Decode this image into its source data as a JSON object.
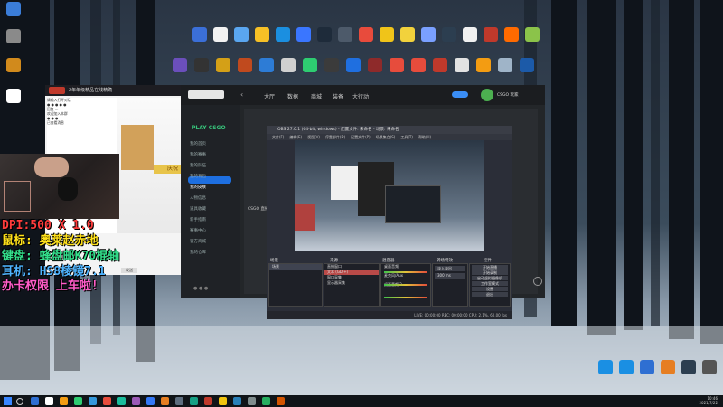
{
  "desktop": {
    "icons_row1": [
      {
        "label": "",
        "color": "#3b6fd8"
      },
      {
        "label": "",
        "color": "#f2f2f2"
      },
      {
        "label": "",
        "color": "#5aa6f0"
      },
      {
        "label": "",
        "color": "#f6c026"
      },
      {
        "label": "",
        "color": "#1b8fe0"
      },
      {
        "label": "",
        "color": "#3a76ff"
      },
      {
        "label": "",
        "color": "#1e2b3a"
      },
      {
        "label": "",
        "color": "#4d5a6a"
      },
      {
        "label": "",
        "color": "#e84b3c"
      },
      {
        "label": "",
        "color": "#f0c419"
      },
      {
        "label": "",
        "color": "#f2d23c"
      },
      {
        "label": "",
        "color": "#7aa0ff"
      },
      {
        "label": "",
        "color": "#2c3e50"
      },
      {
        "label": "",
        "color": "#f1f1f1"
      },
      {
        "label": "",
        "color": "#c0392b"
      },
      {
        "label": "",
        "color": "#ff6a00"
      },
      {
        "label": "",
        "color": "#8bc34a"
      }
    ],
    "icons_row2": [
      {
        "label": "",
        "color": "#6b4fbb"
      },
      {
        "label": "",
        "color": "#333"
      },
      {
        "label": "",
        "color": "#d4a017"
      },
      {
        "label": "",
        "color": "#c04a1e"
      },
      {
        "label": "",
        "color": "#2d7cd6"
      },
      {
        "label": "",
        "color": "#d0d0d0"
      },
      {
        "label": "",
        "color": "#2ecc71"
      },
      {
        "label": "",
        "color": "#3b3b3b"
      },
      {
        "label": "",
        "color": "#1f6fe0"
      },
      {
        "label": "",
        "color": "#8e2a2a"
      },
      {
        "label": "",
        "color": "#e74c3c"
      },
      {
        "label": "",
        "color": "#e74c3c"
      },
      {
        "label": "",
        "color": "#c0392b"
      },
      {
        "label": "",
        "color": "#e2e2e2"
      },
      {
        "label": "",
        "color": "#f39c12"
      },
      {
        "label": "",
        "color": "#9fb4c8"
      },
      {
        "label": "",
        "color": "#1c5aa8"
      }
    ],
    "left_icons": [
      {
        "color": "#3b7dd8"
      },
      {
        "color": "#8a8a8a"
      },
      {
        "color": "#d18a1c"
      },
      {
        "color": "#ffffff"
      }
    ],
    "right_icons": [
      {
        "color": "#1a8fe3"
      },
      {
        "color": "#1a8fe3"
      },
      {
        "color": "#2f6fd2"
      },
      {
        "color": "#e67e22"
      },
      {
        "color": "#2c3e50"
      },
      {
        "color": "#555"
      }
    ]
  },
  "chat": {
    "title": "2年年级精品在线精确",
    "side_lines": [
      "请输入打开对话",
      "● ●  ● ● ●",
      "回复 ... ",
      "欢迎加入本群",
      "●  ● ●",
      "已查看消息"
    ],
    "messages": [
      "新成员   加入了群聊 欢迎",
      "新成员   加入了群聊 欢迎",
      "新成员   加入了群聊 欢迎",
      "新成员   加入了群聊 欢迎"
    ],
    "banner_text": "庆祝",
    "footer": "发送"
  },
  "overlay": {
    "line1": "DPI:500 X 1.0",
    "line2": "鼠标: 奥莱赵赤地",
    "line3": "键盘: 蜂盘邮K70棍轴",
    "line4": "耳机: HS8棱镜7.1",
    "line5": "办卡权限 上车啦!"
  },
  "app": {
    "brand": "PLAY CSGO",
    "nav": [
      "大厅",
      "数据",
      "商城",
      "装备",
      "大行动"
    ],
    "sidebar": [
      "我的首页",
      "我的赛事",
      "我的队伍",
      "我的背包",
      "我的皮肤",
      "人物信息",
      "道具收藏",
      "新手指南",
      "赛事中心",
      "官方商城",
      "我的仓库"
    ],
    "sidebar_footer": "● ●  ●",
    "user": "CSGO 玩家",
    "notice": "CSGO 直播间"
  },
  "obs": {
    "title": "OBS 27.0.1 (64-bit, windows) - 配置文件: 未命名 - 场景: 未命名",
    "menu": [
      "文件(F)",
      "编辑(E)",
      "视图(V)",
      "停靠部件(D)",
      "配置文件(P)",
      "场景集合(S)",
      "工具(T)",
      "帮助(H)"
    ],
    "docks": [
      "场景",
      "来源",
      "混音器",
      "转场特效",
      "控件"
    ],
    "scenes": [
      "场景"
    ],
    "sources": [
      "直播窗口",
      "文本 (GDI+)",
      "窗口采集",
      "显示器采集"
    ],
    "mixer": [
      "桌面音频",
      "麦克风/Aux",
      "桌面音频 2"
    ],
    "transition": "淡入淡出",
    "duration": "300 ms",
    "controls": [
      "开始直播",
      "开始录制",
      "启动虚拟摄像机",
      "工作室模式",
      "设置",
      "退出"
    ],
    "status": "LIVE: 00:00:00   REC: 00:00:00   CPU: 2.1%, 60.00 fps"
  },
  "taskbar": {
    "time": "10:46",
    "date": "2021/7/22",
    "apps": [
      {
        "color": "#2f6fd2"
      },
      {
        "color": "#ffffff"
      },
      {
        "color": "#f39c12"
      },
      {
        "color": "#2ecc71"
      },
      {
        "color": "#3498db"
      },
      {
        "color": "#e74c3c"
      },
      {
        "color": "#1abc9c"
      },
      {
        "color": "#9b59b6"
      },
      {
        "color": "#3478f6"
      },
      {
        "color": "#e67e22"
      },
      {
        "color": "#5d6d7e"
      },
      {
        "color": "#16a085"
      },
      {
        "color": "#c0392b"
      },
      {
        "color": "#f1c40f"
      },
      {
        "color": "#2980b9"
      },
      {
        "color": "#7f8c8d"
      },
      {
        "color": "#27ae60"
      },
      {
        "color": "#d35400"
      }
    ]
  }
}
